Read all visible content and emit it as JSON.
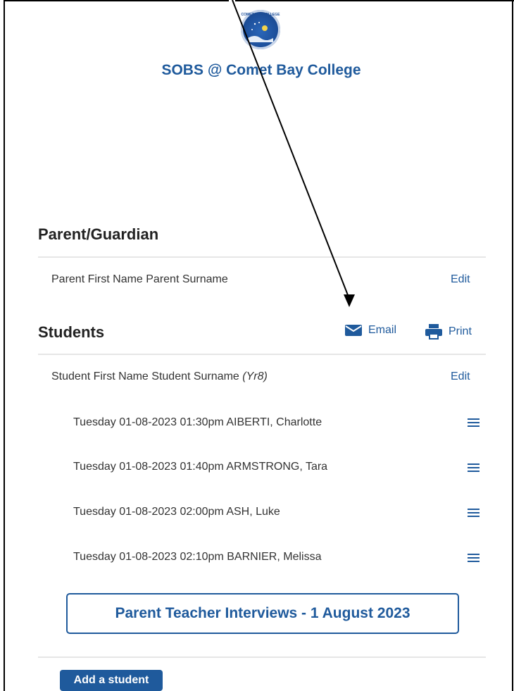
{
  "header": {
    "logo_text": "COMET BAY COLLEGE",
    "site_title": "SOBS @ Comet Bay College"
  },
  "parent_section": {
    "title": "Parent/Guardian",
    "parent_name": "Parent First Name Parent Surname",
    "edit_label": "Edit"
  },
  "students_section": {
    "title": "Students",
    "email_label": "Email",
    "print_label": "Print",
    "student_name": "Student First Name Student Surname",
    "student_year": "(Yr8)",
    "edit_label": "Edit",
    "appointments": [
      "Tuesday 01-08-2023 01:30pm AIBERTI, Charlotte",
      "Tuesday 01-08-2023 01:40pm ARMSTRONG, Tara",
      "Tuesday 01-08-2023 02:00pm ASH, Luke",
      "Tuesday 01-08-2023 02:10pm BARNIER, Melissa"
    ],
    "event_label": "Parent Teacher Interviews - 1 August 2023",
    "add_student_label": "Add a student"
  },
  "colors": {
    "accent": "#1f5a9c",
    "text": "#333333",
    "divider": "#e6e6e6"
  },
  "icons": [
    "logo",
    "email-icon",
    "print-icon",
    "menu-icon",
    "arrow-annotation"
  ]
}
